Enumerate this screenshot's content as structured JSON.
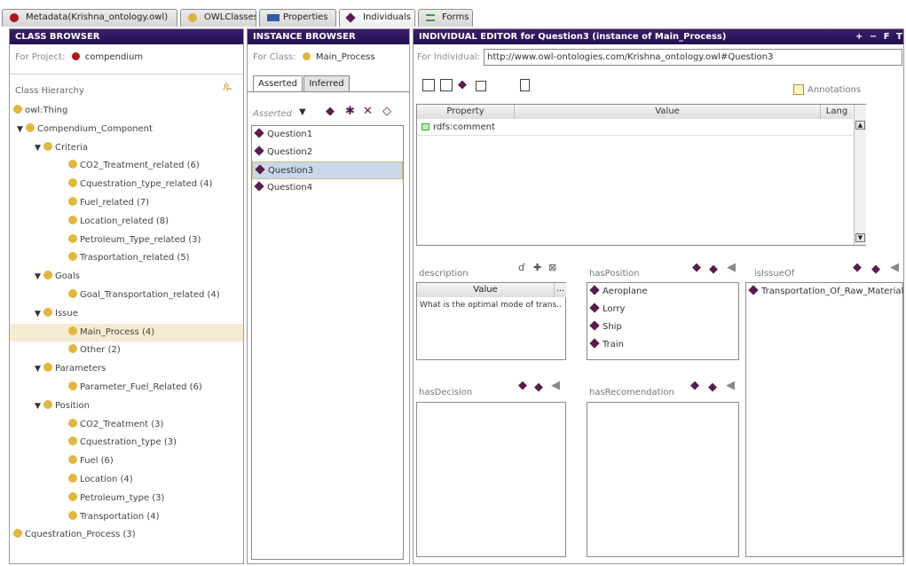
{
  "tabs": [
    {
      "label": "Metadata(Krishna_ontology.owl)",
      "icon": "metadata-icon",
      "color": "#b0151a"
    },
    {
      "label": "OWLClasses",
      "icon": "classes-icon",
      "color": "#d9b43a"
    },
    {
      "label": "Properties",
      "icon": "properties-icon",
      "color": "#2f5ca8"
    },
    {
      "label": "Individuals",
      "icon": "individuals-icon",
      "color": "#5a1b4e"
    },
    {
      "label": "Forms",
      "icon": "forms-icon",
      "color": "#3c9a3c"
    }
  ],
  "class_browser": {
    "title": "CLASS BROWSER",
    "for_project_label": "For Project:",
    "project_name": "compendium",
    "hierarchy_label": "Class Hierarchy",
    "tree": [
      {
        "label": "owl:Thing",
        "depth": 0,
        "expander": ""
      },
      {
        "label": "Compendium_Component",
        "depth": 0,
        "expander": "▼"
      },
      {
        "label": "Criteria",
        "depth": 1,
        "expander": "▼"
      },
      {
        "label": "CO2_Treatment_related (6)",
        "depth": 2,
        "expander": ""
      },
      {
        "label": "Cquestration_type_related (4)",
        "depth": 2,
        "expander": ""
      },
      {
        "label": "Fuel_related (7)",
        "depth": 2,
        "expander": ""
      },
      {
        "label": "Location_related (8)",
        "depth": 2,
        "expander": ""
      },
      {
        "label": "Petroleum_Type_related (3)",
        "depth": 2,
        "expander": ""
      },
      {
        "label": "Trasportation_related (5)",
        "depth": 2,
        "expander": ""
      },
      {
        "label": "Goals",
        "depth": 1,
        "expander": "▼"
      },
      {
        "label": "Goal_Transportation_related (4)",
        "depth": 2,
        "expander": ""
      },
      {
        "label": "Issue",
        "depth": 1,
        "expander": "▼"
      },
      {
        "label": "Main_Process (4)",
        "depth": 2,
        "expander": "",
        "selected": true
      },
      {
        "label": "Other (2)",
        "depth": 2,
        "expander": ""
      },
      {
        "label": "Parameters",
        "depth": 1,
        "expander": "▼"
      },
      {
        "label": "Parameter_Fuel_Related (6)",
        "depth": 2,
        "expander": ""
      },
      {
        "label": "Position",
        "depth": 1,
        "expander": "▼"
      },
      {
        "label": "CO2_Treatment (3)",
        "depth": 2,
        "expander": ""
      },
      {
        "label": "Cquestration_type (3)",
        "depth": 2,
        "expander": ""
      },
      {
        "label": "Fuel (6)",
        "depth": 2,
        "expander": ""
      },
      {
        "label": "Location (4)",
        "depth": 2,
        "expander": ""
      },
      {
        "label": "Petroleum_type (3)",
        "depth": 2,
        "expander": ""
      },
      {
        "label": "Transportation (4)",
        "depth": 2,
        "expander": ""
      },
      {
        "label": "Cquestration_Process (3)",
        "depth": 0,
        "expander": ""
      }
    ]
  },
  "instance_browser": {
    "title": "INSTANCE BROWSER",
    "for_class_label": "For Class:",
    "class_name": "Main_Process",
    "tab_asserted": "Asserted",
    "tab_inferred": "Inferred",
    "list_label": "Asserted",
    "instances": [
      "Question1",
      "Question2",
      "Question3",
      "Question4"
    ],
    "selected_index": 2
  },
  "individual_editor": {
    "title": "INDIVIDUAL EDITOR for Question3   (instance of Main_Process)",
    "title_controls": "+ − F T",
    "for_individual_label": "For Individual:",
    "individual_uri": "http://www.owl-ontologies.com/Krishna_ontology.owl#Question3",
    "annotations_label": "Annotations",
    "columns": [
      "Property",
      "Value",
      "Lang"
    ],
    "rows": [
      {
        "property": "rdfs:comment",
        "value": "",
        "lang": ""
      }
    ],
    "description": {
      "title": "description",
      "col_value": "Value",
      "col_more": "...",
      "value": "What is the optimal mode of trans..."
    },
    "has_position": {
      "title": "hasPosition",
      "items": [
        "Aeroplane",
        "Lorry",
        "Ship",
        "Train"
      ]
    },
    "is_issue_of": {
      "title": "isIssueOf",
      "items": [
        "Transportation_Of_Raw_Materials"
      ]
    },
    "has_decision": {
      "title": "hasDecision",
      "items": []
    },
    "has_recomendation": {
      "title": "hasRecomendation",
      "items": []
    }
  },
  "colors": {
    "header_bg": "#2a1458",
    "class_dot": "#e2b73c",
    "instance_diamond": "#5a1b4e",
    "project_dot": "#b0151a",
    "selection": "#f6ead0",
    "rdfs_icon": "#3caa3c"
  }
}
